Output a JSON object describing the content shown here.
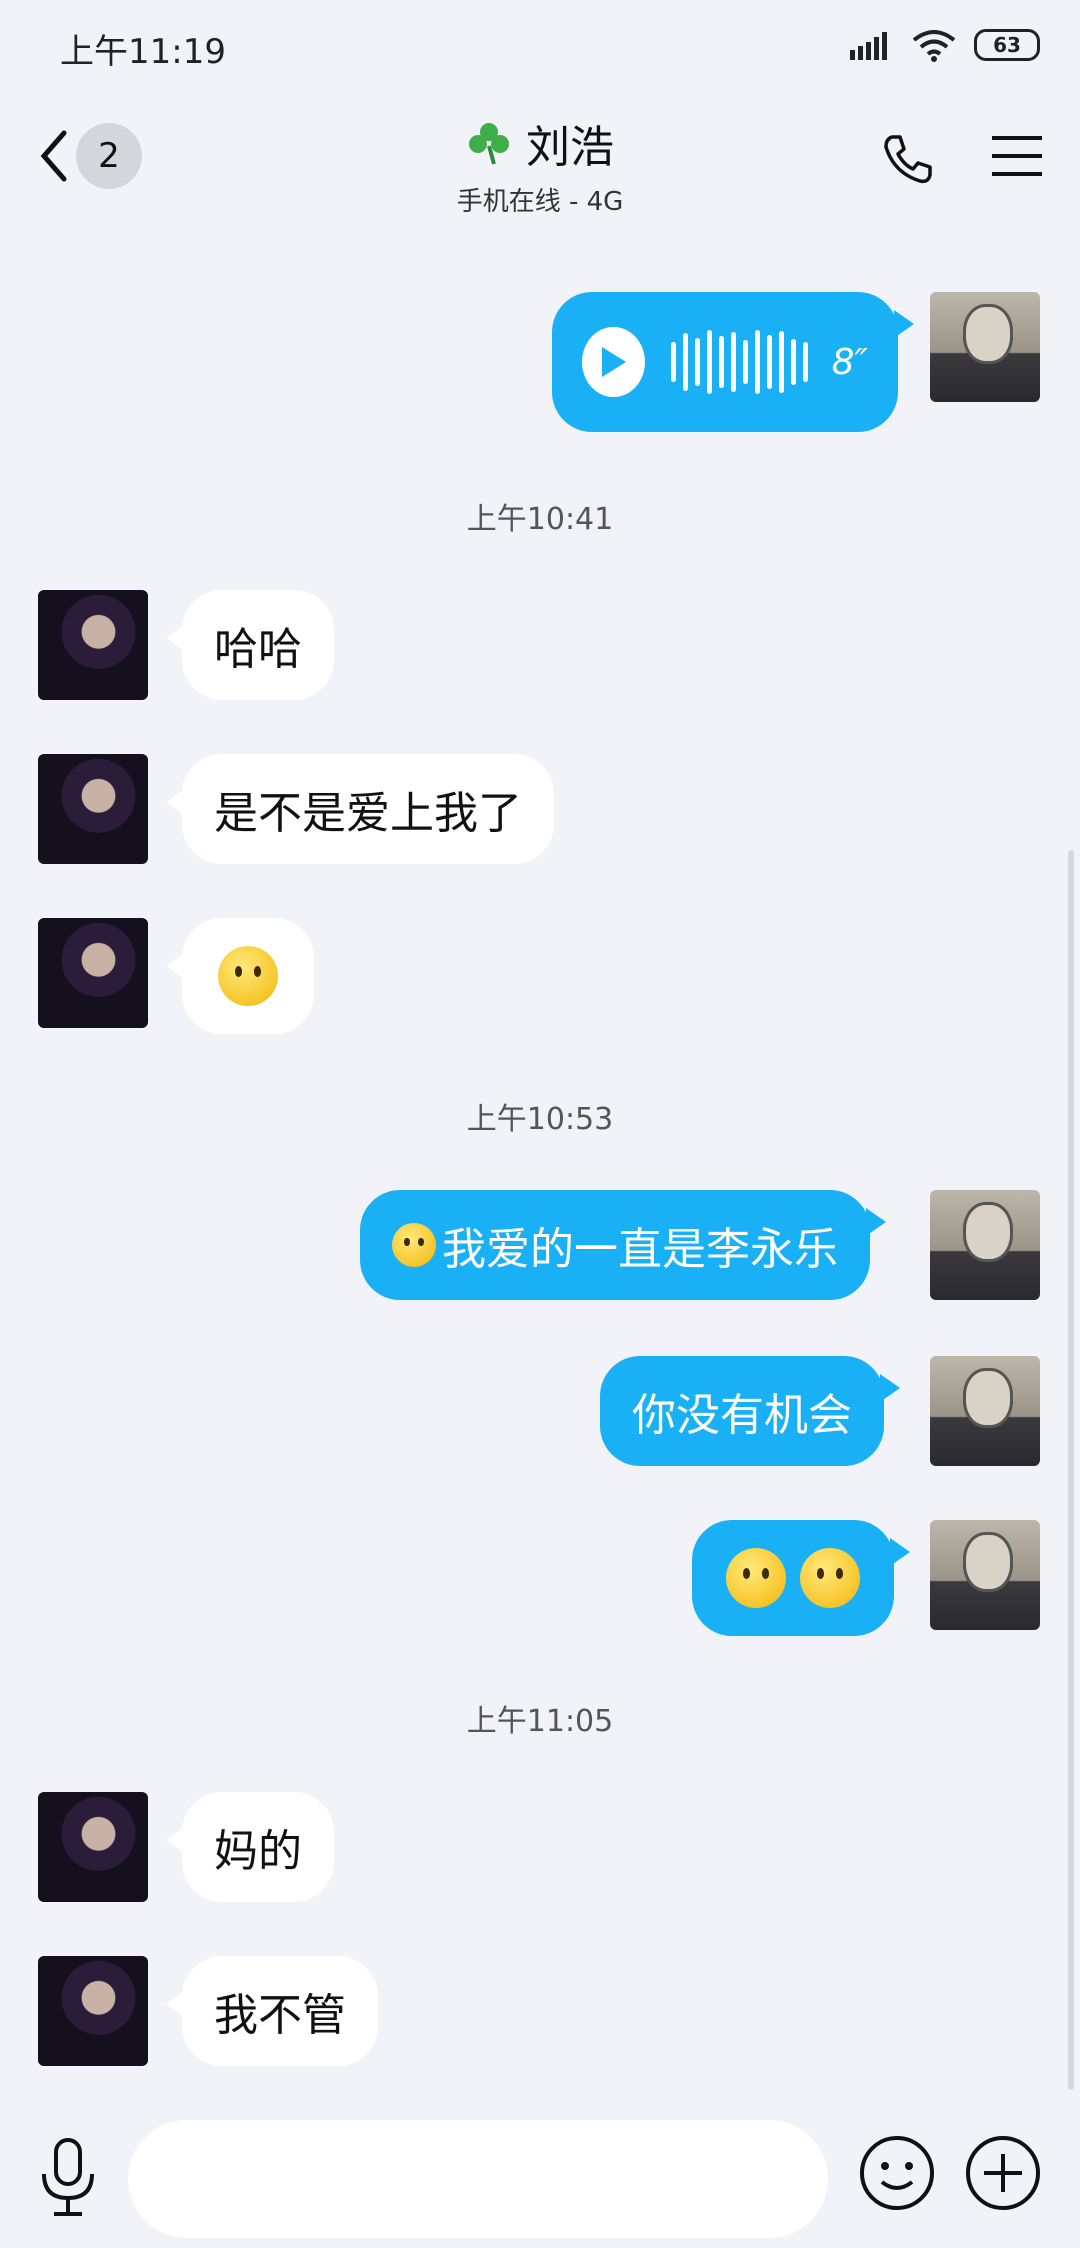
{
  "status_bar": {
    "time": "上午11:19",
    "battery": "63"
  },
  "header": {
    "back_badge": "2",
    "contact_name": "刘浩",
    "contact_status": "手机在线 - 4G",
    "leaf_icon": "clover-icon"
  },
  "messages": [
    {
      "type": "voice",
      "direction": "out",
      "duration": "8″"
    },
    {
      "type": "time",
      "text": "上午10:41"
    },
    {
      "type": "text",
      "direction": "in",
      "text": "哈哈"
    },
    {
      "type": "text",
      "direction": "in",
      "text": "是不是爱上我了"
    },
    {
      "type": "emoji",
      "direction": "in",
      "emoji": "shy-face-emoji"
    },
    {
      "type": "time",
      "text": "上午10:53"
    },
    {
      "type": "text",
      "direction": "out",
      "text": "我爱的一直是李永乐",
      "prefix_emoji": "shy-face-emoji"
    },
    {
      "type": "text",
      "direction": "out",
      "text": "你没有机会"
    },
    {
      "type": "emoji",
      "direction": "out",
      "emoji": "shy-face-emoji-x2"
    },
    {
      "type": "time",
      "text": "上午11:05"
    },
    {
      "type": "text",
      "direction": "in",
      "text": "妈的"
    },
    {
      "type": "text",
      "direction": "in",
      "text": "我不管"
    }
  ],
  "input": {
    "value": "",
    "placeholder": ""
  },
  "colors": {
    "outgoing_bubble": "#1ab0f5",
    "incoming_bubble": "#ffffff",
    "background": "#f2f3f9"
  }
}
